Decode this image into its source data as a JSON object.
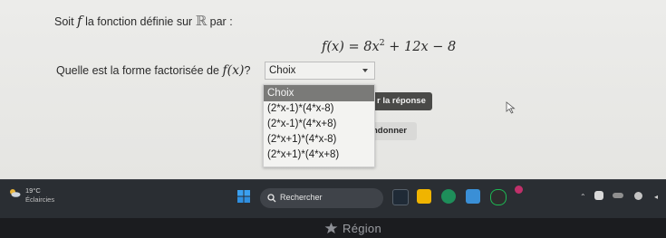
{
  "question": {
    "intro_before": "Soit",
    "intro_f": "f",
    "intro_middle": "la fonction définie sur",
    "intro_set": "ℝ",
    "intro_after": "par :",
    "formula": {
      "lhs": "f(x)",
      "equals": "=",
      "a": "8x",
      "a_exp": "2",
      "rest": "+ 12x − 8"
    },
    "prompt_before": "Quelle est la forme factorisée de",
    "prompt_fx": "f(x)",
    "prompt_after": "?"
  },
  "select": {
    "value": "Choix",
    "options": [
      "Choix",
      "(2*x-1)*(4*x-8)",
      "(2*x-1)*(4*x+8)",
      "(2*x+1)*(4*x-8)",
      "(2*x+1)*(4*x+8)"
    ],
    "highlighted_index": 0
  },
  "buttons": {
    "verify_visible": "r la réponse",
    "abandon_visible": "ndonner"
  },
  "taskbar": {
    "temperature": "19°C",
    "condition": "Éclaircies",
    "search_placeholder": "Rechercher"
  },
  "bezel": {
    "brand": "Région"
  },
  "colors": {
    "page_bg": "#e7e7e4",
    "selected_option_bg": "#7a7a78",
    "verify_button_bg": "#4a4a48",
    "taskbar_bg": "#2a2e33"
  }
}
